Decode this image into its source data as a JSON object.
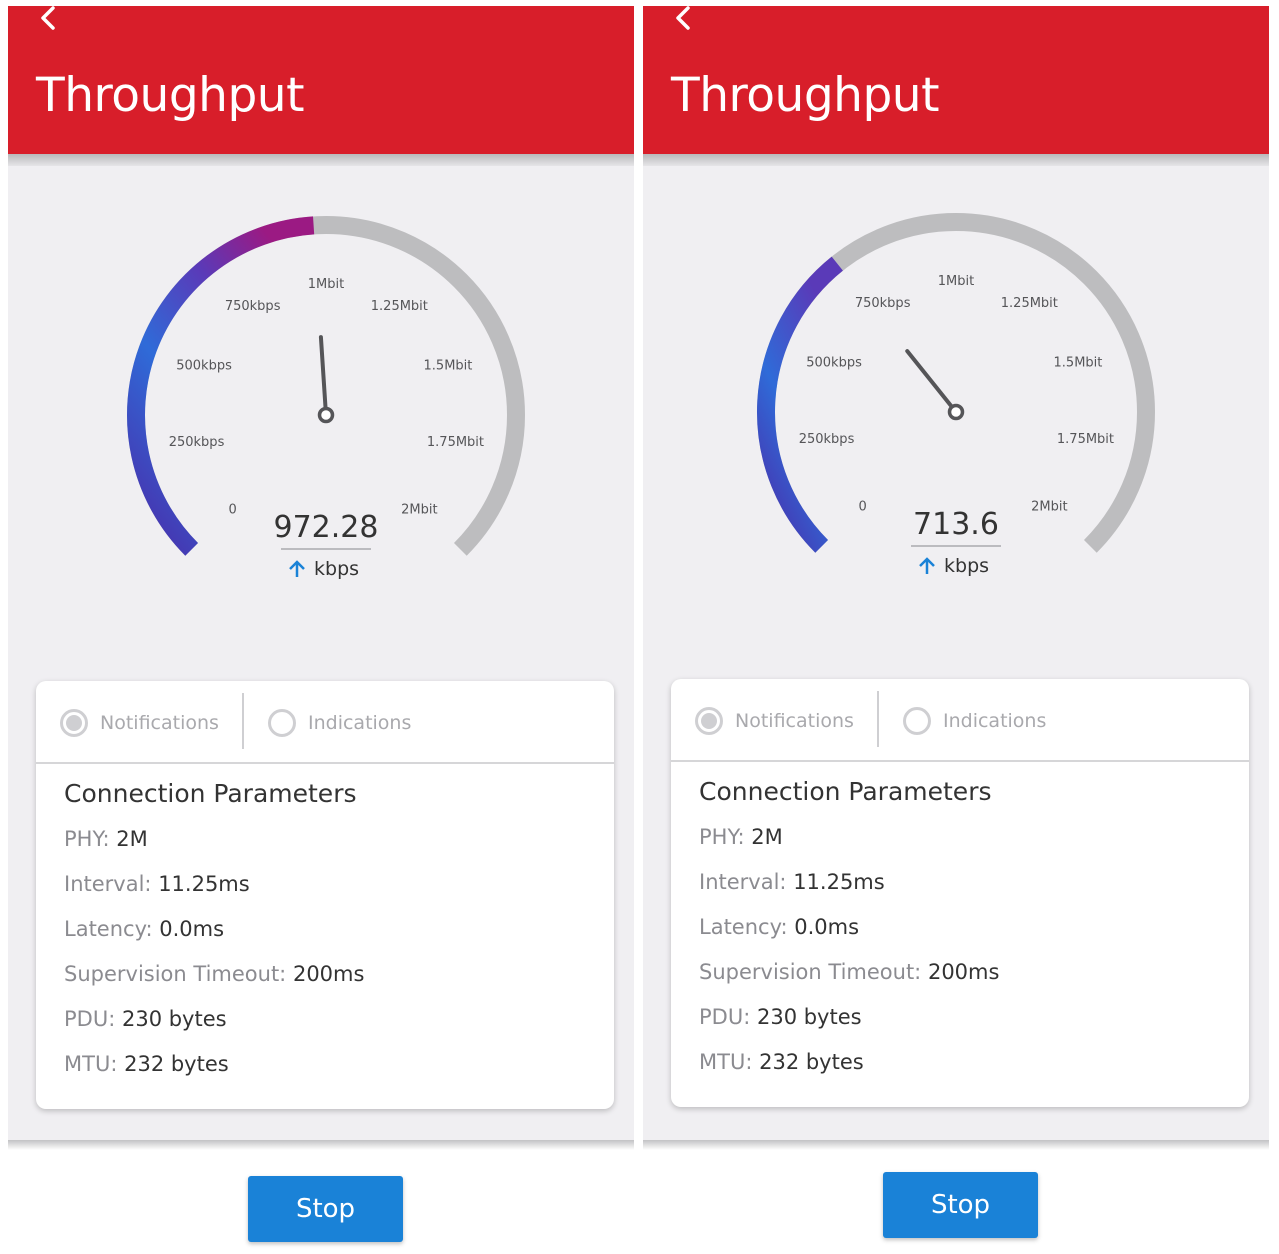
{
  "colors": {
    "header": "#d81e2a",
    "accent": "#1a82d7",
    "gauge_start": "#4b2aa8",
    "gauge_mid": "#2f6bd8",
    "gauge_end": "#9b1a83",
    "gauge_track": "#bdbdbf"
  },
  "screens": [
    {
      "title": "Throughput",
      "back_icon": "chevron-left-icon",
      "gauge": {
        "value": "972.28",
        "value_kbps": 972.28,
        "max_kbps": 2000,
        "unit": "kbps",
        "unit_icon": "arrow-up-icon",
        "ticks": [
          "0",
          "250kbps",
          "500kbps",
          "750kbps",
          "1Mbit",
          "1.25Mbit",
          "1.5Mbit",
          "1.75Mbit",
          "2Mbit"
        ]
      },
      "tabs": [
        {
          "label": "Notifications",
          "selected": true
        },
        {
          "label": "Indications",
          "selected": false
        }
      ],
      "params_title": "Connection Parameters",
      "params": [
        {
          "key": "PHY:",
          "value": "2M"
        },
        {
          "key": "Interval:",
          "value": "11.25ms"
        },
        {
          "key": "Latency:",
          "value": "0.0ms"
        },
        {
          "key": "Supervision Timeout:",
          "value": "200ms"
        },
        {
          "key": "PDU:",
          "value": "230 bytes"
        },
        {
          "key": "MTU:",
          "value": "232 bytes"
        }
      ],
      "stop_label": "Stop"
    },
    {
      "title": "Throughput",
      "back_icon": "chevron-left-icon",
      "gauge": {
        "value": "713.6",
        "value_kbps": 713.6,
        "max_kbps": 2000,
        "unit": "kbps",
        "unit_icon": "arrow-up-icon",
        "ticks": [
          "0",
          "250kbps",
          "500kbps",
          "750kbps",
          "1Mbit",
          "1.25Mbit",
          "1.5Mbit",
          "1.75Mbit",
          "2Mbit"
        ]
      },
      "tabs": [
        {
          "label": "Notifications",
          "selected": true
        },
        {
          "label": "Indications",
          "selected": false
        }
      ],
      "params_title": "Connection Parameters",
      "params": [
        {
          "key": "PHY:",
          "value": "2M"
        },
        {
          "key": "Interval:",
          "value": "11.25ms"
        },
        {
          "key": "Latency:",
          "value": "0.0ms"
        },
        {
          "key": "Supervision Timeout:",
          "value": "200ms"
        },
        {
          "key": "PDU:",
          "value": "230 bytes"
        },
        {
          "key": "MTU:",
          "value": "232 bytes"
        }
      ],
      "stop_label": "Stop"
    }
  ]
}
